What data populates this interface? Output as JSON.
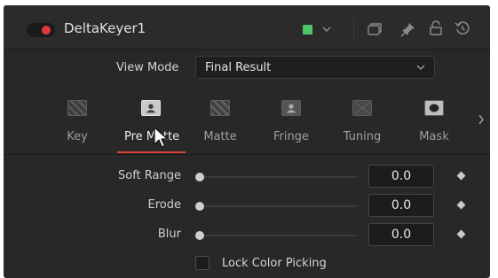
{
  "header": {
    "title": "DeltaKeyer1",
    "enable_toggle": true,
    "toggle_color": "#e03a3a",
    "color_swatch": "#4fc36a",
    "icons": [
      "chevron-down-icon",
      "version-icon",
      "pin-icon",
      "lock-icon",
      "reset-icon"
    ]
  },
  "view_mode": {
    "label": "View Mode",
    "value": "Final Result"
  },
  "tabs": [
    {
      "label": "Key"
    },
    {
      "label": "Pre Matte"
    },
    {
      "label": "Matte"
    },
    {
      "label": "Fringe"
    },
    {
      "label": "Tuning"
    },
    {
      "label": "Mask"
    }
  ],
  "active_tab": "Pre Matte",
  "accent_color": "#d9433a",
  "controls": [
    {
      "label": "Soft Range",
      "value": "0.0",
      "slider_fraction": 0
    },
    {
      "label": "Erode",
      "value": "0.0",
      "slider_fraction": 0
    },
    {
      "label": "Blur",
      "value": "0.0",
      "slider_fraction": 0
    }
  ],
  "checkbox": {
    "label": "Lock Color Picking",
    "checked": false
  }
}
